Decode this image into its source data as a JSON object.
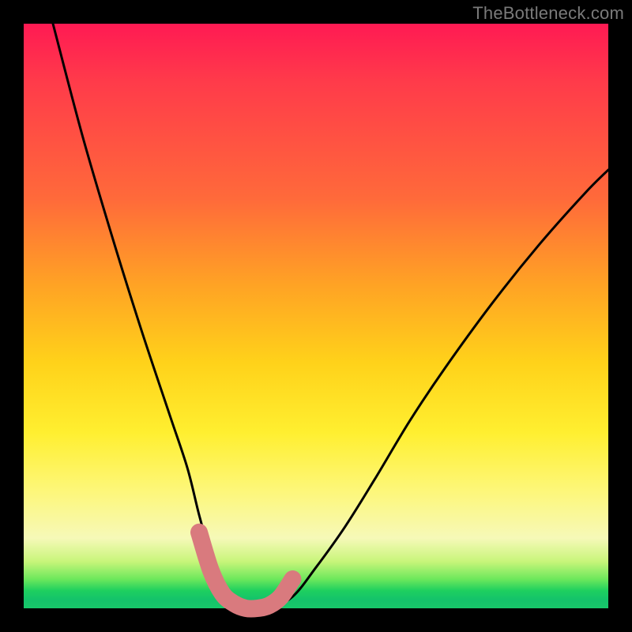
{
  "watermark": "TheBottleneck.com",
  "chart_data": {
    "type": "line",
    "title": "",
    "xlabel": "",
    "ylabel": "",
    "x_range": [
      0,
      100
    ],
    "y_range": [
      0,
      100
    ],
    "series": [
      {
        "name": "curve",
        "x": [
          5,
          10,
          15,
          20,
          25,
          28,
          30,
          32,
          34,
          36,
          38,
          42,
          46,
          50,
          55,
          60,
          66,
          72,
          80,
          88,
          96,
          100
        ],
        "y": [
          100,
          81,
          64,
          48,
          33,
          24,
          16,
          9,
          4,
          1,
          0,
          0,
          2,
          7,
          14,
          22,
          32,
          41,
          52,
          62,
          71,
          75
        ]
      }
    ],
    "highlight": {
      "name": "bottom-arc",
      "color": "#d97a7e",
      "x": [
        30,
        32,
        34,
        36,
        38,
        40,
        42,
        44,
        46
      ],
      "y": [
        13,
        6.5,
        2.5,
        0.8,
        0,
        0,
        0.5,
        2,
        5
      ]
    }
  },
  "colors": {
    "curve": "#000000",
    "highlight": "#d97a7e",
    "frame": "#000000"
  }
}
